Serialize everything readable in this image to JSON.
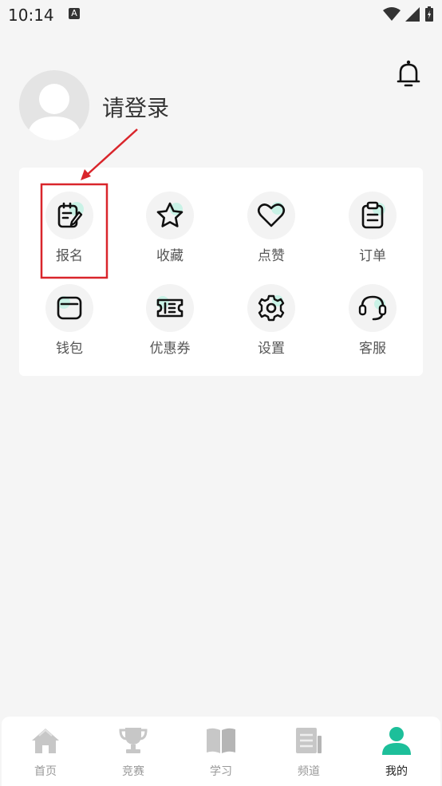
{
  "status_bar": {
    "time": "10:14",
    "notification_letter": "A"
  },
  "profile": {
    "login_prompt": "请登录"
  },
  "colors": {
    "accent": "#1dbf9a",
    "annotation": "#d9252b",
    "icon": "#111111",
    "tab_inactive": "#c7c7c7"
  },
  "grid": {
    "items": [
      {
        "label": "报名",
        "icon": "signup-icon"
      },
      {
        "label": "收藏",
        "icon": "star-icon"
      },
      {
        "label": "点赞",
        "icon": "heart-icon"
      },
      {
        "label": "订单",
        "icon": "clipboard-icon"
      },
      {
        "label": "钱包",
        "icon": "wallet-icon"
      },
      {
        "label": "优惠券",
        "icon": "coupon-icon"
      },
      {
        "label": "设置",
        "icon": "gear-icon"
      },
      {
        "label": "客服",
        "icon": "headset-icon"
      }
    ]
  },
  "tabs": [
    {
      "label": "首页",
      "icon": "home-icon",
      "active": false
    },
    {
      "label": "竞赛",
      "icon": "trophy-icon",
      "active": false
    },
    {
      "label": "学习",
      "icon": "book-icon",
      "active": false
    },
    {
      "label": "频道",
      "icon": "news-icon",
      "active": false
    },
    {
      "label": "我的",
      "icon": "user-icon",
      "active": true
    }
  ]
}
